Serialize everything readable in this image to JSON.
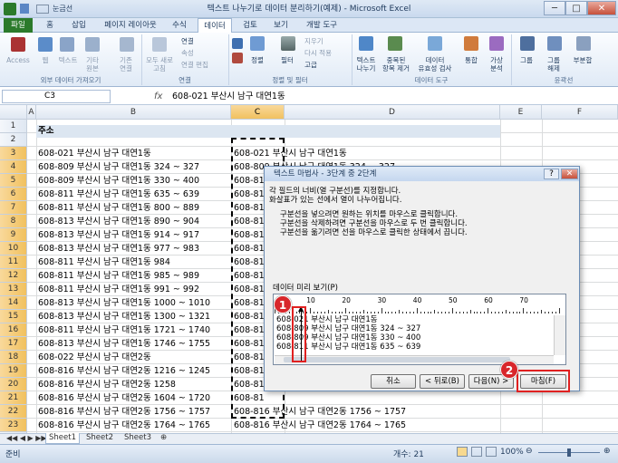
{
  "window": {
    "title": "텍스트 나누기로 데이터 분리하기(예제) - Microsoft Excel",
    "qat_label": "눈금선",
    "min": "─",
    "max": "□",
    "close": "✕"
  },
  "tabs": [
    "파일",
    "홈",
    "삽입",
    "페이지 레이아웃",
    "수식",
    "데이터",
    "검토",
    "보기",
    "개발 도구"
  ],
  "ribbon": {
    "access": "Access",
    "web": "웹",
    "text": "텍스트",
    "other": "기타\n원본",
    "existing": "기존\n연결",
    "refresh_all": "모두 새로\n고침",
    "connections": "연결",
    "properties": "속성",
    "edit_links": "연결 편집",
    "sort": "정렬",
    "filter": "필터",
    "clear": "지우기",
    "reapply": "다시 적용",
    "advanced": "고급",
    "text_to_columns": "텍스트\n나누기",
    "remove_dup": "중복된\n항목 제거",
    "validation": "데이터\n유효성 검사",
    "consolidate": "통합",
    "whatif": "가상\n분석",
    "group": "그룹",
    "ungroup": "그룹\n해제",
    "subtotal": "부분합",
    "groups": {
      "external": "외부 데이터 가져오기",
      "conn": "연결",
      "sortfilter": "정렬 및 필터",
      "tools": "데이터 도구",
      "outline": "윤곽선"
    }
  },
  "formula_bar": {
    "name_box": "C3",
    "fx": "fx",
    "value": "608-021 부산시 남구 대연1동"
  },
  "columns": [
    "A",
    "B",
    "C",
    "D",
    "E",
    "F"
  ],
  "rows": [
    "1",
    "2",
    "3",
    "4",
    "5",
    "6",
    "7",
    "8",
    "9",
    "10",
    "11",
    "12",
    "13",
    "14",
    "15",
    "16",
    "17",
    "18",
    "19",
    "20",
    "21",
    "22",
    "23",
    "24"
  ],
  "header_cell": "주소",
  "col_b": [
    "608-021 부산시 남구 대연1동",
    "608-809 부산시 남구 대연1동 324 ~ 327",
    "608-809 부산시 남구 대연1동 330 ~ 400",
    "608-811 부산시 남구 대연1동 635 ~ 639",
    "608-811 부산시 남구 대연1동 800 ~ 889",
    "608-813 부산시 남구 대연1동 890 ~ 904",
    "608-813 부산시 남구 대연1동 914 ~ 917",
    "608-813 부산시 남구 대연1동 977 ~ 983",
    "608-811 부산시 남구 대연1동 984",
    "608-811 부산시 남구 대연1동 985 ~ 989",
    "608-811 부산시 남구 대연1동 991 ~ 992",
    "608-813 부산시 남구 대연1동 1000 ~ 1010",
    "608-813 부산시 남구 대연1동 1300 ~ 1321",
    "608-811 부산시 남구 대연1동 1721 ~ 1740",
    "608-813 부산시 남구 대연1동 1746 ~ 1755",
    "608-022 부산시 남구 대연2동",
    "608-816 부산시 남구 대연2동 1216 ~ 1245",
    "608-816 부산시 남구 대연2동 1258",
    "608-816 부산시 남구 대연2동 1604 ~ 1720",
    "608-816 부산시 남구 대연2동 1756 ~ 1757",
    "608-816 부산시 남구 대연2동 1764 ~ 1765"
  ],
  "col_c": [
    "608-021 부산시 남구 대연1동",
    "608-809 부산시 남구 대연1동 324 ~ 327",
    "608-81",
    "608-81",
    "608-81",
    "608-81",
    "608-81",
    "608-81",
    "608-81",
    "608-81",
    "608-81",
    "608-81",
    "608-81",
    "608-81",
    "608-81",
    "608-81",
    "608-81",
    "608-81",
    "608-81",
    "608-816 부산시 남구 대연2동 1756 ~ 1757",
    "608-816 부산시 남구 대연2동 1764 ~ 1765"
  ],
  "sheets": [
    "Sheet1",
    "Sheet2",
    "Sheet3"
  ],
  "status": {
    "mode": "준비",
    "count": "개수: 21",
    "zoom": "100%"
  },
  "dialog": {
    "title": "텍스트 마법사 - 3단계 중 2단계",
    "help": "?",
    "close": "✕",
    "line1": "각 필드의 너비(열 구분선)를 지정합니다.",
    "line2": "화살표가 있는 선에서 열이 나누어집니다.",
    "line3": "구분선을 넣으려면 원하는 위치를 마우스로 클릭합니다.",
    "line4": "구분선을 삭제하려면 구분선을 마우스로 두 번 클릭합니다.",
    "line5": "구분선을 옮기려면 선을 마우스로 클릭한 상태에서 끕니다.",
    "preview_label": "데이터 미리 보기(P)",
    "ruler": [
      "10",
      "20",
      "30",
      "40",
      "50",
      "60",
      "70"
    ],
    "preview": [
      "608-021 부산시 남구 대연1동",
      "608-809 부산시 남구 대연1동 324 ~ 327",
      "608-809 부산시 남구 대연1동 330 ~ 400",
      "608-811 부산시 남구 대연1동 635 ~ 639"
    ],
    "cancel": "취소",
    "back": "< 뒤로(B)",
    "next": "다음(N) >",
    "finish": "마침(F)"
  },
  "badges": [
    "1",
    "2"
  ]
}
